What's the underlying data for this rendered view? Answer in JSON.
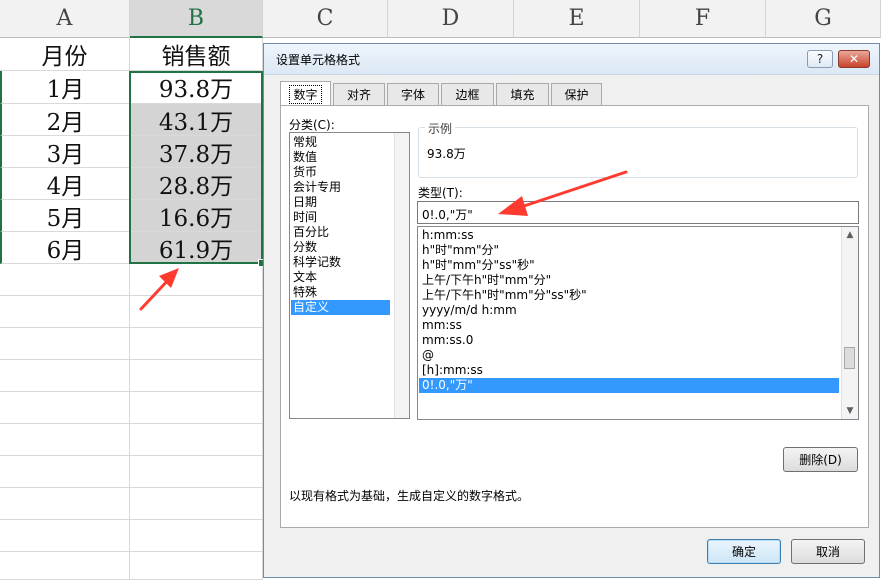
{
  "sheet": {
    "columns": [
      "A",
      "B",
      "C",
      "D",
      "E",
      "F",
      "G"
    ],
    "header_row": {
      "month": "月份",
      "sales": "销售额"
    },
    "rows": [
      {
        "month": "1月",
        "sales": "93.8万"
      },
      {
        "month": "2月",
        "sales": "43.1万"
      },
      {
        "month": "3月",
        "sales": "37.8万"
      },
      {
        "month": "4月",
        "sales": "28.8万"
      },
      {
        "month": "5月",
        "sales": "16.6万"
      },
      {
        "month": "6月",
        "sales": "61.9万"
      }
    ],
    "accent_color": "#217346",
    "annotation_color": "#ff3b30"
  },
  "dialog": {
    "title": "设置单元格格式",
    "help_label": "?",
    "close_label": "✕",
    "tabs": [
      "数字",
      "对齐",
      "字体",
      "边框",
      "填充",
      "保护"
    ],
    "active_tab": "数字",
    "category_label": "分类(C):",
    "categories": [
      "常规",
      "数值",
      "货币",
      "会计专用",
      "日期",
      "时间",
      "百分比",
      "分数",
      "科学记数",
      "文本",
      "特殊",
      "自定义"
    ],
    "selected_category": "自定义",
    "sample_group_title": "示例",
    "sample_value": "93.8万",
    "type_label": "类型(T):",
    "type_value": "0!.0,\"万\"",
    "formats": [
      "h:mm:ss",
      "h\"时\"mm\"分\"",
      "h\"时\"mm\"分\"ss\"秒\"",
      "上午/下午h\"时\"mm\"分\"",
      "上午/下午h\"时\"mm\"分\"ss\"秒\"",
      "yyyy/m/d h:mm",
      "mm:ss",
      "mm:ss.0",
      "@",
      "[h]:mm:ss",
      "0!.0,\"万\""
    ],
    "selected_format": "0!.0,\"万\"",
    "delete_label": "删除(D)",
    "description": "以现有格式为基础，生成自定义的数字格式。",
    "ok_label": "确定",
    "cancel_label": "取消",
    "selection_color": "#3399ff"
  }
}
